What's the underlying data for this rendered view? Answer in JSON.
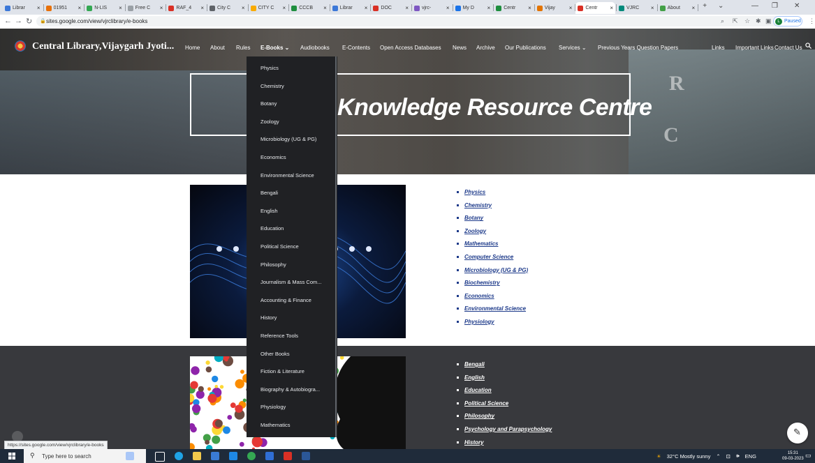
{
  "browser": {
    "tabs": [
      {
        "label": "Librar"
      },
      {
        "label": "01951"
      },
      {
        "label": "N-LIS"
      },
      {
        "label": "Free C"
      },
      {
        "label": "RAF_4"
      },
      {
        "label": "City C"
      },
      {
        "label": "CITY C"
      },
      {
        "label": "CCCB"
      },
      {
        "label": "Librar"
      },
      {
        "label": "DOC"
      },
      {
        "label": "vjrc-"
      },
      {
        "label": "My D"
      },
      {
        "label": "Centr"
      },
      {
        "label": "Vijay"
      },
      {
        "label": "Centr"
      },
      {
        "label": "VJRC"
      },
      {
        "label": "About"
      }
    ],
    "url": "sites.google.com/view/vjrclibrary/e-books",
    "profile_status": "Paused",
    "profile_initial": "L"
  },
  "site": {
    "name": "Central Library,Vijaygarh Jyoti...",
    "nav": [
      "Home",
      "About",
      "Rules",
      "E-Books",
      "Audiobooks",
      "E-Contents",
      "Open Access Databases",
      "News",
      "Archive",
      "Our Publications",
      "Services",
      "Previous Years Question Papers",
      "Links",
      "Important Links",
      "Contact Us"
    ],
    "hero_title": "Knowledge Resource Centre",
    "hero_letters": [
      "R",
      "C"
    ]
  },
  "dropdown": {
    "items": [
      "Physics",
      "Chemistry",
      "Botany",
      "Zoology",
      "Microbiology (UG & PG)",
      "Economics",
      "Environmental Science",
      "Bengali",
      "English",
      "Education",
      "Political Science",
      "Philosophy",
      "Journalism & Mass Com...",
      "Accounting & Finance",
      "History",
      "Reference Tools",
      "Other Books",
      "Fiction & Literature",
      "Biography & Autobiogra...",
      "Physiology",
      "Mathematics"
    ]
  },
  "section1": {
    "links": [
      "Physics",
      "Chemistry",
      "Botany",
      "Zoology",
      "Mathematics",
      "Computer Science",
      "Microbiology (UG & PG)",
      "Biochemistry",
      "Economics",
      "Environmental Science",
      "Physiology"
    ]
  },
  "section2": {
    "links": [
      "Bengali",
      "English",
      "Education",
      "Political Science",
      "Philosophy",
      "Psychology and Parapsychology",
      "History"
    ]
  },
  "status_url": "https://sites.google.com/view/vjrclibrary/e-books",
  "taskbar": {
    "search_placeholder": "Type here to search",
    "weather": "32°C  Mostly sunny",
    "language": "ENG",
    "time": "15:31",
    "date": "09-03-2023"
  },
  "colors": {
    "link_blue": "#1d3a8a",
    "dropdown_bg": "#202124",
    "dark_section": "#38393d",
    "taskbar": "#1f2b3a"
  }
}
